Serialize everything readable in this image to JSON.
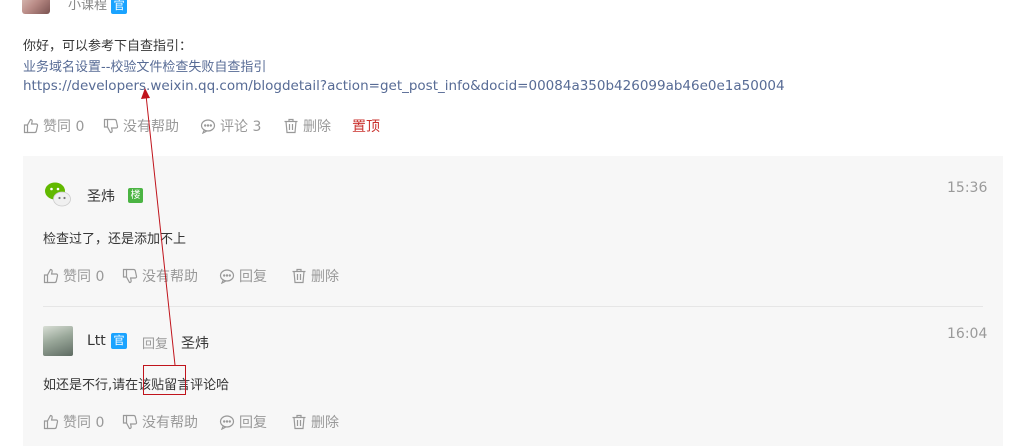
{
  "post": {
    "author_name": "小课程",
    "author_badge": "官",
    "lines": [
      "你好，可以参考下自查指引：",
      "业务域名设置--校验文件检查失败自查指引",
      "https://developers.weixin.qq.com/blogdetail?action=get_post_info&docid=00084a350b426099ab46e0e1a50004"
    ],
    "actions": {
      "like": "赞同 0",
      "unhelpful": "没有帮助",
      "comment": "评论 3",
      "delete": "删除",
      "pin": "置顶"
    }
  },
  "replies": [
    {
      "name": "圣炜",
      "badge": "楼",
      "time": "15:36",
      "text": "检查过了，还是添加不上",
      "actions": {
        "like": "赞同 0",
        "unhelpful": "没有帮助",
        "reply": "回复",
        "delete": "删除"
      }
    },
    {
      "name": "Ltt",
      "badge": "官",
      "reply_word": "回复",
      "reply_to": "圣炜",
      "time": "16:04",
      "text_parts": [
        "如还是不行,请在",
        "该贴留",
        "言评论哈"
      ],
      "actions": {
        "like": "赞同 0",
        "unhelpful": "没有帮助",
        "reply": "回复",
        "delete": "删除"
      }
    }
  ],
  "colors": {
    "link": "#576b95",
    "pin": "#c9302c",
    "badge_guan": "#1aa3ff",
    "badge_lou": "#4bb443",
    "annotation": "#c0141c"
  }
}
